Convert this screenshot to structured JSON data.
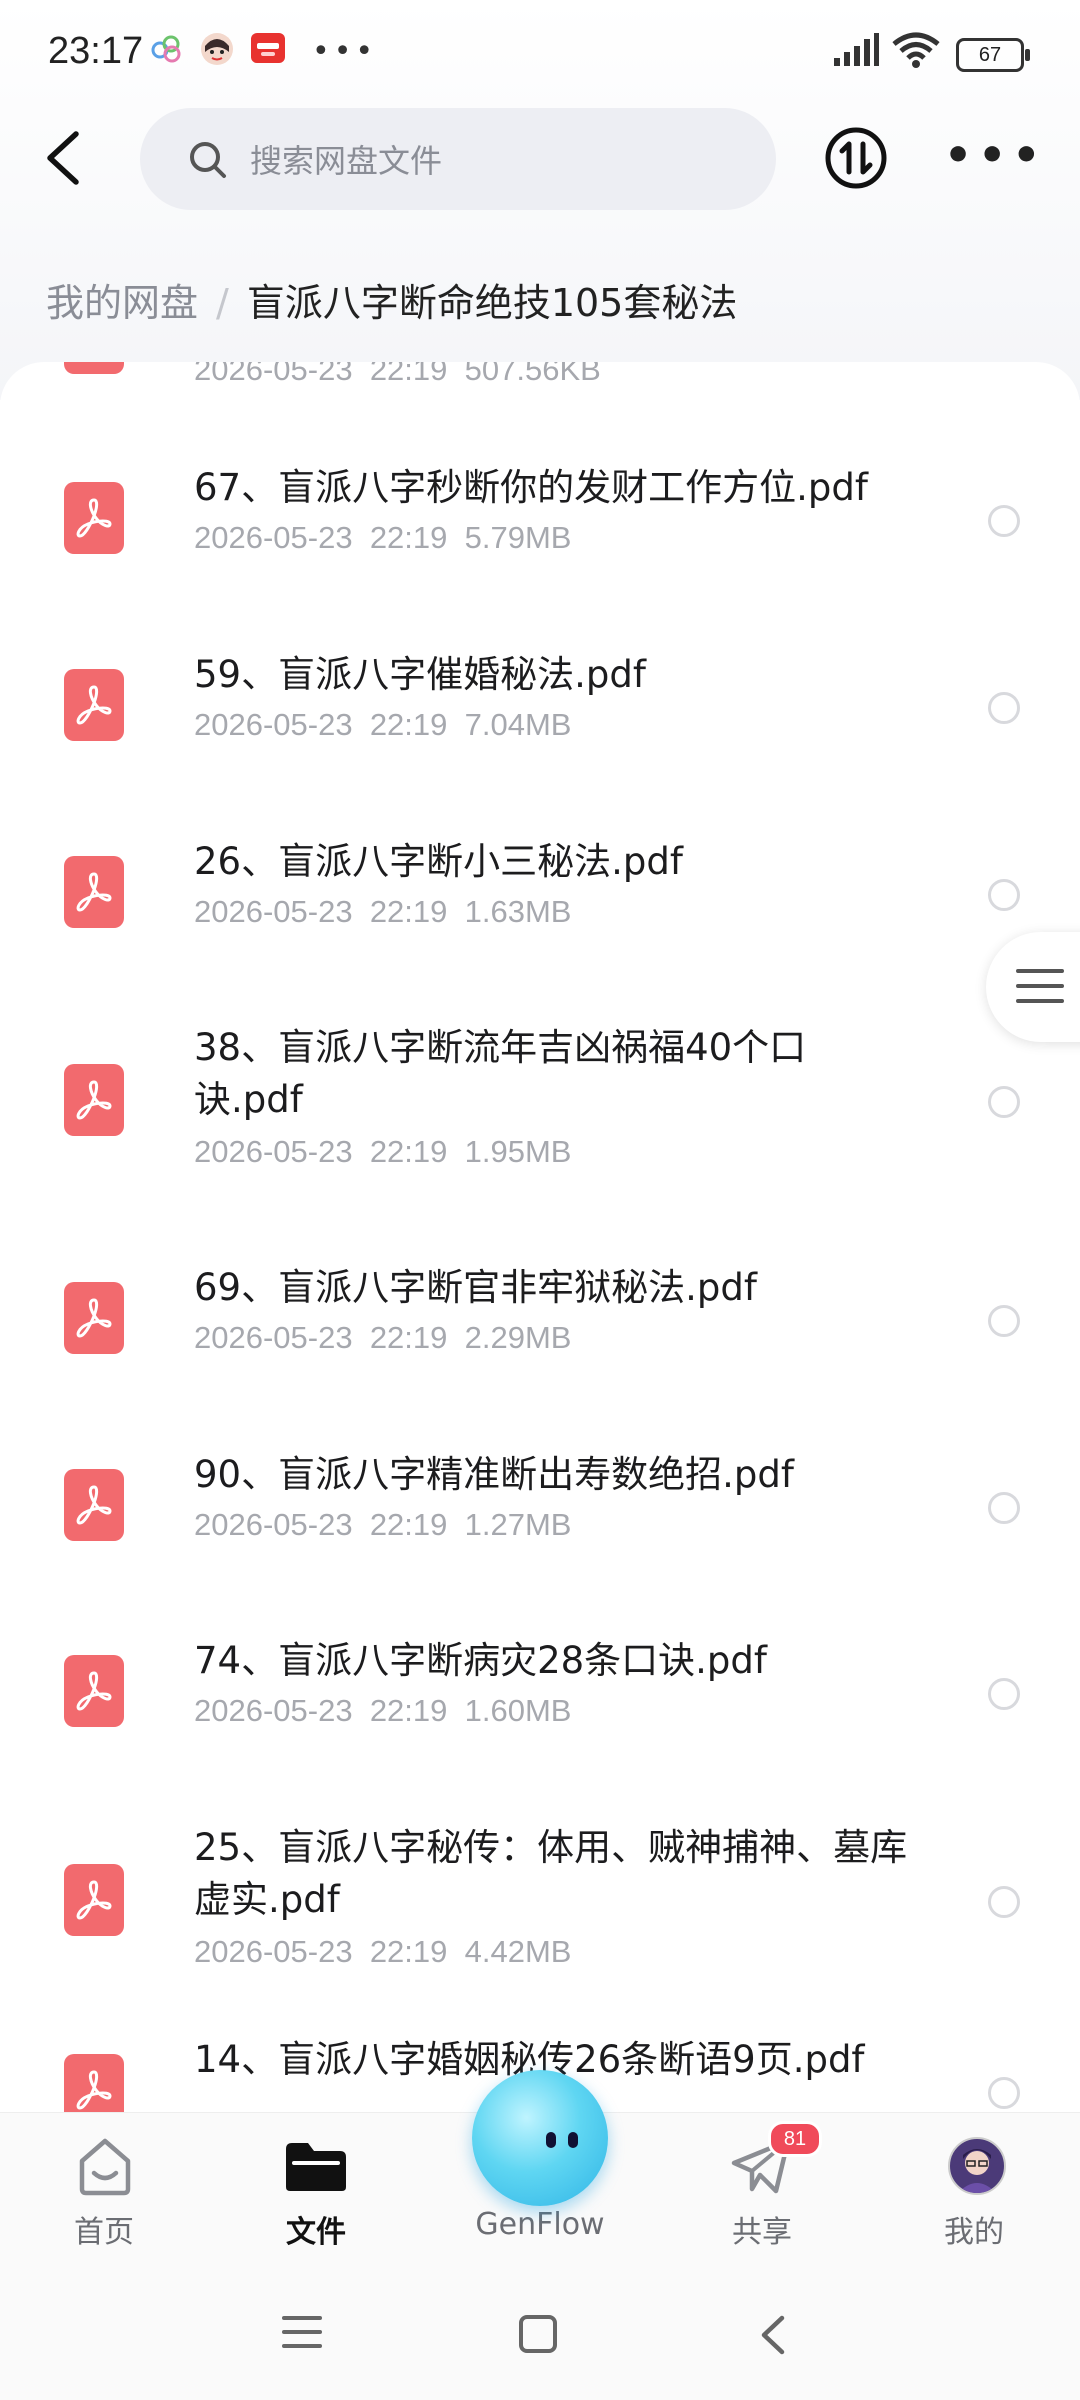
{
  "status": {
    "time": "23:17",
    "battery": "67"
  },
  "header": {
    "search_placeholder": "搜索网盘文件"
  },
  "breadcrumb": {
    "root": "我的网盘",
    "separator": "/",
    "current": "盲派八字断命绝技105套秘法"
  },
  "files": [
    {
      "name": "",
      "date": "2026-05-23",
      "time": "22:19",
      "size": "507.56KB"
    },
    {
      "name": "67、盲派八字秒断你的发财工作方位.pdf",
      "date": "2026-05-23",
      "time": "22:19",
      "size": "5.79MB"
    },
    {
      "name": "59、盲派八字催婚秘法.pdf",
      "date": "2026-05-23",
      "time": "22:19",
      "size": "7.04MB"
    },
    {
      "name": "26、盲派八字断小三秘法.pdf",
      "date": "2026-05-23",
      "time": "22:19",
      "size": "1.63MB"
    },
    {
      "name": "38、盲派八字断流年吉凶祸福40个口诀.pdf",
      "date": "2026-05-23",
      "time": "22:19",
      "size": "1.95MB"
    },
    {
      "name": "69、盲派八字断官非牢狱秘法.pdf",
      "date": "2026-05-23",
      "time": "22:19",
      "size": "2.29MB"
    },
    {
      "name": "90、盲派八字精准断出寿数绝招.pdf",
      "date": "2026-05-23",
      "time": "22:19",
      "size": "1.27MB"
    },
    {
      "name": "74、盲派八字断病灾28条口诀.pdf",
      "date": "2026-05-23",
      "time": "22:19",
      "size": "1.60MB"
    },
    {
      "name": "25、盲派八字秘传：体用、贼神捕神、墓库虚实.pdf",
      "date": "2026-05-23",
      "time": "22:19",
      "size": "4.42MB"
    },
    {
      "name": "14、盲派八字婚姻秘传26条断语9页.pdf",
      "date": "",
      "time": "",
      "size": ""
    }
  ],
  "bottom_nav": {
    "home": "首页",
    "files": "文件",
    "genflow": "GenFlow",
    "share": "共享",
    "share_badge": "81",
    "mine": "我的"
  },
  "colors": {
    "pdf_red": "#f26a6e",
    "badge_red": "#f04a5a"
  }
}
